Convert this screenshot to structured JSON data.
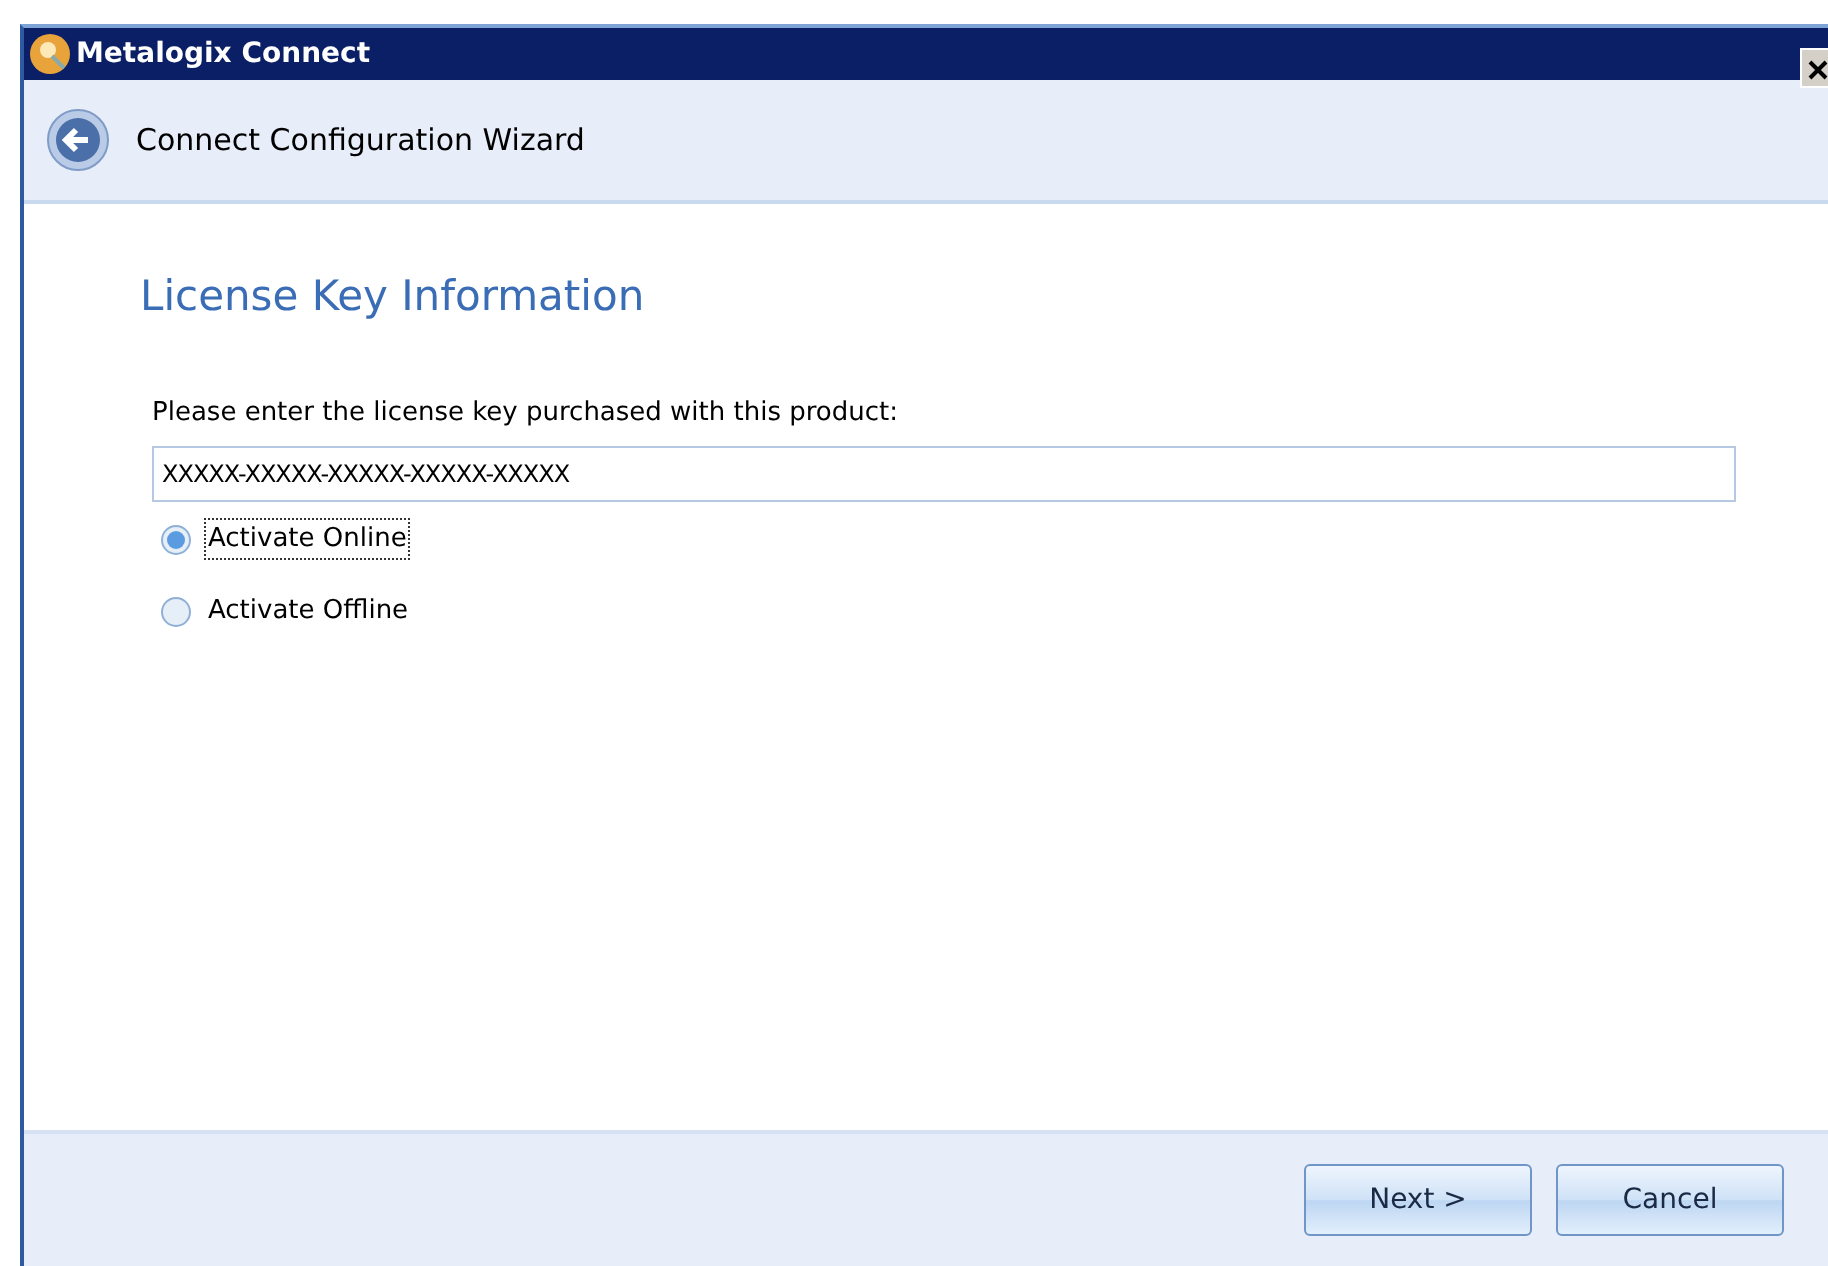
{
  "window": {
    "title": "Metalogix Connect"
  },
  "header": {
    "title": "Connect Configuration Wizard"
  },
  "page": {
    "heading": "License Key Information",
    "prompt": "Please enter the license key purchased with this product:",
    "license_key": "XXXXX-XXXXX-XXXXX-XXXXX-XXXXX"
  },
  "options": [
    {
      "label": "Activate Online",
      "selected": true,
      "focused": true
    },
    {
      "label": "Activate Offline",
      "selected": false,
      "focused": false
    }
  ],
  "buttons": [
    {
      "label": "Next >"
    },
    {
      "label": "Cancel"
    }
  ]
}
